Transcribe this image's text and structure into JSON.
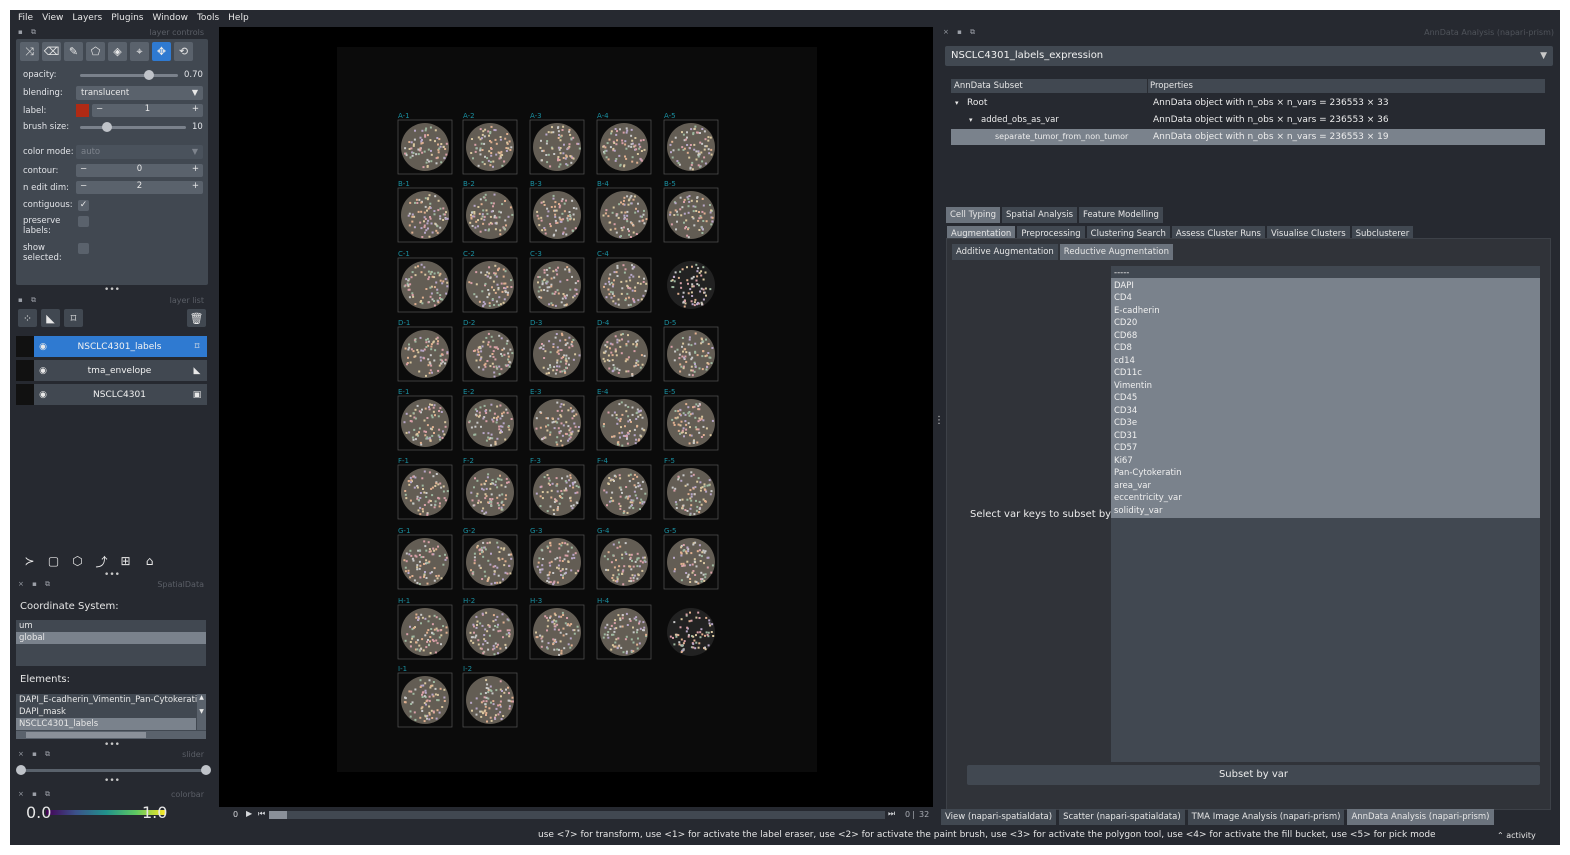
{
  "menubar": [
    "File",
    "View",
    "Layers",
    "Plugins",
    "Window",
    "Tools",
    "Help"
  ],
  "layer_controls": {
    "title": "layer controls",
    "opacity_label": "opacity:",
    "opacity_value": "0.70",
    "opacity_fraction": 0.7,
    "blending_label": "blending:",
    "blending_value": "translucent",
    "label_label": "label:",
    "label_value": "1",
    "label_color": "#b02a14",
    "brush_label": "brush size:",
    "brush_value": "10",
    "brush_fraction": 0.25,
    "color_mode_label": "color mode:",
    "color_mode_value": "auto",
    "contour_label": "contour:",
    "contour_value": "0",
    "n_edit_label": "n edit dim:",
    "n_edit_value": "2",
    "contiguous_label": "contiguous:",
    "preserve_label": "preserve labels:",
    "show_selected_label": "show selected:"
  },
  "layer_list": {
    "title": "layer list",
    "layers": [
      {
        "name": "NSCLC4301_labels",
        "selected": true,
        "type_icon": "tag-icon"
      },
      {
        "name": "tma_envelope",
        "selected": false,
        "type_icon": "shapes-icon"
      },
      {
        "name": "NSCLC4301",
        "selected": false,
        "type_icon": "image-icon"
      }
    ]
  },
  "spatialdata": {
    "title": "SpatialData",
    "coord_label": "Coordinate System:",
    "coords": [
      {
        "name": "um",
        "selected": false
      },
      {
        "name": "global",
        "selected": true
      }
    ],
    "elements_label": "Elements:",
    "elements": [
      {
        "name": "DAPI_E-cadherin_Vimentin_Pan-Cytokerati",
        "selected": false
      },
      {
        "name": "DAPI_mask",
        "selected": false
      },
      {
        "name": "NSCLC4301_labels",
        "selected": true
      }
    ]
  },
  "slider_title": "slider",
  "colorbar": {
    "title": "colorbar",
    "min": "0.0",
    "max": "1.0"
  },
  "canvas": {
    "cores": [
      {
        "label": "A-1"
      },
      {
        "label": "A-2"
      },
      {
        "label": "A-3"
      },
      {
        "label": "A-4"
      },
      {
        "label": "A-5"
      },
      {
        "label": "B-1"
      },
      {
        "label": "B-2"
      },
      {
        "label": "B-3"
      },
      {
        "label": "B-4"
      },
      {
        "label": "B-5"
      },
      {
        "label": "C-1"
      },
      {
        "label": "C-2"
      },
      {
        "label": "C-3"
      },
      {
        "label": "C-4"
      },
      {
        "label": ""
      },
      {
        "label": "D-1"
      },
      {
        "label": "D-2"
      },
      {
        "label": "D-3"
      },
      {
        "label": "D-4"
      },
      {
        "label": "D-5"
      },
      {
        "label": "E-1"
      },
      {
        "label": "E-2"
      },
      {
        "label": "E-3"
      },
      {
        "label": "E-4"
      },
      {
        "label": "E-5"
      },
      {
        "label": "F-1"
      },
      {
        "label": "F-2"
      },
      {
        "label": "F-3"
      },
      {
        "label": "F-4"
      },
      {
        "label": "F-5"
      },
      {
        "label": "G-1"
      },
      {
        "label": "G-2"
      },
      {
        "label": "G-3"
      },
      {
        "label": "G-4"
      },
      {
        "label": "G-5"
      },
      {
        "label": "H-1"
      },
      {
        "label": "H-2"
      },
      {
        "label": "H-3"
      },
      {
        "label": "H-4"
      },
      {
        "label": ""
      },
      {
        "label": "I-1"
      },
      {
        "label": "I-2"
      },
      {
        "label": ""
      },
      {
        "label": ""
      },
      {
        "label": ""
      }
    ]
  },
  "dims": {
    "frame": "0",
    "total": "32"
  },
  "anndata": {
    "title": "AnnData Analysis (napari-prism)",
    "dataset": "NSCLC4301_labels_expression",
    "tree_headers": [
      "AnnData Subset",
      "Properties"
    ],
    "tree_rows": [
      {
        "name": "Root",
        "props": "AnnData object with n_obs × n_vars = 236553 × 33",
        "selected": false
      },
      {
        "name": "added_obs_as_var",
        "props": "AnnData object with n_obs × n_vars = 236553 × 36",
        "selected": false
      },
      {
        "name": "separate_tumor_from_non_tumor",
        "props": "AnnData object with n_obs × n_vars = 236553 × 19",
        "selected": true
      }
    ],
    "main_tabs": [
      {
        "label": "Cell Typing",
        "active": true
      },
      {
        "label": "Spatial Analysis",
        "active": false
      },
      {
        "label": "Feature Modelling",
        "active": false
      }
    ],
    "sub_tabs": [
      {
        "label": "Augmentation",
        "active": true
      },
      {
        "label": "Preprocessing",
        "active": false
      },
      {
        "label": "Clustering Search",
        "active": false
      },
      {
        "label": "Assess Cluster Runs",
        "active": false
      },
      {
        "label": "Visualise Clusters",
        "active": false
      },
      {
        "label": "Subclusterer",
        "active": false
      }
    ],
    "aug_tabs": [
      {
        "label": "Additive Augmentation",
        "active": false
      },
      {
        "label": "Reductive Augmentation",
        "active": true
      }
    ],
    "select_label": "Select var keys to subset by",
    "var_keys": [
      "-----",
      "DAPI",
      "CD4",
      "E-cadherin",
      "CD20",
      "CD68",
      "CD8",
      "cd14",
      "CD11c",
      "Vimentin",
      "CD45",
      "CD34",
      "CD3e",
      "CD31",
      "CD57",
      "Ki67",
      "Pan-Cytokeratin",
      "area_var",
      "eccentricity_var",
      "solidity_var"
    ],
    "subset_button": "Subset by var"
  },
  "bottom_tabs": [
    {
      "label": "View (napari-spatialdata)",
      "active": false
    },
    {
      "label": "Scatter (napari-spatialdata)",
      "active": false
    },
    {
      "label": "TMA Image Analysis (napari-prism)",
      "active": false
    },
    {
      "label": "AnnData Analysis (napari-prism)",
      "active": true
    }
  ],
  "status": {
    "message": "use <7> for transform, use <1> for activate the label eraser, use <2> for activate the paint brush, use <3> for activate the polygon tool, use <4> for activate the fill bucket, use <5> for pick mode",
    "activity": "activity"
  },
  "colors": {
    "accent": "#2f7ad1",
    "panel": "#414851",
    "background": "#262930",
    "core_label": "#1a8fa0"
  }
}
